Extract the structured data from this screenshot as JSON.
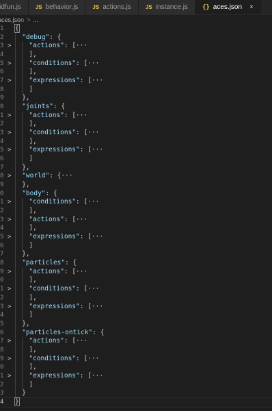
{
  "tabs": [
    {
      "icon": "",
      "label": "quidfun.js",
      "active": false
    },
    {
      "icon": "JS",
      "label": "behavior.js",
      "active": false
    },
    {
      "icon": "JS",
      "label": "actions.js",
      "active": false
    },
    {
      "icon": "JS",
      "label": "instance.js",
      "active": false
    },
    {
      "icon": "{}",
      "label": "aces.json",
      "active": true,
      "close": "×"
    }
  ],
  "breadcrumb": {
    "file": "aces.json",
    "separator": ">",
    "rest": "..."
  },
  "line_numbers": [
    "1",
    "2",
    "3",
    "4",
    "5",
    "6",
    "7",
    "8",
    "9",
    "0",
    "1",
    "2",
    "3",
    "4",
    "5",
    "6",
    "7",
    "8",
    "9",
    "0",
    "1",
    "2",
    "3",
    "4",
    "5",
    "6",
    "7",
    "8",
    "9",
    "0",
    "1",
    "2",
    "3",
    "4",
    "5",
    "6",
    "7",
    "8",
    "9",
    "0",
    "1",
    "2",
    "3",
    "4"
  ],
  "code_lines": [
    {
      "indent": 0,
      "fold": "",
      "text": "{"
    },
    {
      "indent": 1,
      "fold": "",
      "key": "\"debug\"",
      "text": ": {"
    },
    {
      "indent": 2,
      "fold": ">",
      "key": "\"actions\"",
      "text": ": [···"
    },
    {
      "indent": 2,
      "fold": "",
      "text": "],"
    },
    {
      "indent": 2,
      "fold": ">",
      "key": "\"conditions\"",
      "text": ": [···"
    },
    {
      "indent": 2,
      "fold": "",
      "text": "],"
    },
    {
      "indent": 2,
      "fold": ">",
      "key": "\"expressions\"",
      "text": ": [···"
    },
    {
      "indent": 2,
      "fold": "",
      "text": "]"
    },
    {
      "indent": 1,
      "fold": "",
      "text": "},"
    },
    {
      "indent": 1,
      "fold": "",
      "key": "\"joints\"",
      "text": ": {"
    },
    {
      "indent": 2,
      "fold": ">",
      "key": "\"actions\"",
      "text": ": [···"
    },
    {
      "indent": 2,
      "fold": "",
      "text": "],"
    },
    {
      "indent": 2,
      "fold": ">",
      "key": "\"conditions\"",
      "text": ": [···"
    },
    {
      "indent": 2,
      "fold": "",
      "text": "],"
    },
    {
      "indent": 2,
      "fold": ">",
      "key": "\"expressions\"",
      "text": ": [···"
    },
    {
      "indent": 2,
      "fold": "",
      "text": "]"
    },
    {
      "indent": 1,
      "fold": "",
      "text": "},"
    },
    {
      "indent": 1,
      "fold": ">",
      "key": "\"world\"",
      "text": ": {···"
    },
    {
      "indent": 1,
      "fold": "",
      "text": "},"
    },
    {
      "indent": 1,
      "fold": "",
      "key": "\"body\"",
      "text": ": {"
    },
    {
      "indent": 2,
      "fold": ">",
      "key": "\"conditions\"",
      "text": ": [···"
    },
    {
      "indent": 2,
      "fold": "",
      "text": "],"
    },
    {
      "indent": 2,
      "fold": ">",
      "key": "\"actions\"",
      "text": ": [···"
    },
    {
      "indent": 2,
      "fold": "",
      "text": "],"
    },
    {
      "indent": 2,
      "fold": ">",
      "key": "\"expressions\"",
      "text": ": [···"
    },
    {
      "indent": 2,
      "fold": "",
      "text": "]"
    },
    {
      "indent": 1,
      "fold": "",
      "text": "},"
    },
    {
      "indent": 1,
      "fold": "",
      "key": "\"particles\"",
      "text": ": {"
    },
    {
      "indent": 2,
      "fold": ">",
      "key": "\"actions\"",
      "text": ": [···"
    },
    {
      "indent": 2,
      "fold": "",
      "text": "],"
    },
    {
      "indent": 2,
      "fold": ">",
      "key": "\"conditions\"",
      "text": ": [···"
    },
    {
      "indent": 2,
      "fold": "",
      "text": "],"
    },
    {
      "indent": 2,
      "fold": ">",
      "key": "\"expressions\"",
      "text": ": [···"
    },
    {
      "indent": 2,
      "fold": "",
      "text": "]"
    },
    {
      "indent": 1,
      "fold": "",
      "text": "},"
    },
    {
      "indent": 1,
      "fold": "",
      "key": "\"particles-ontick\"",
      "text": ": {"
    },
    {
      "indent": 2,
      "fold": ">",
      "key": "\"actions\"",
      "text": ": [···"
    },
    {
      "indent": 2,
      "fold": "",
      "text": "],"
    },
    {
      "indent": 2,
      "fold": ">",
      "key": "\"conditions\"",
      "text": ": [···"
    },
    {
      "indent": 2,
      "fold": "",
      "text": "],"
    },
    {
      "indent": 2,
      "fold": ">",
      "key": "\"expressions\"",
      "text": ": [···"
    },
    {
      "indent": 2,
      "fold": "",
      "text": "]"
    },
    {
      "indent": 1,
      "fold": "",
      "text": "}"
    },
    {
      "indent": 0,
      "fold": "",
      "text": "}",
      "current": true
    }
  ],
  "colors": {
    "key": "#9cdcfe",
    "punct": "#d4d4d4",
    "background": "#1e1e1e",
    "tab_icon": "#e8c441"
  }
}
